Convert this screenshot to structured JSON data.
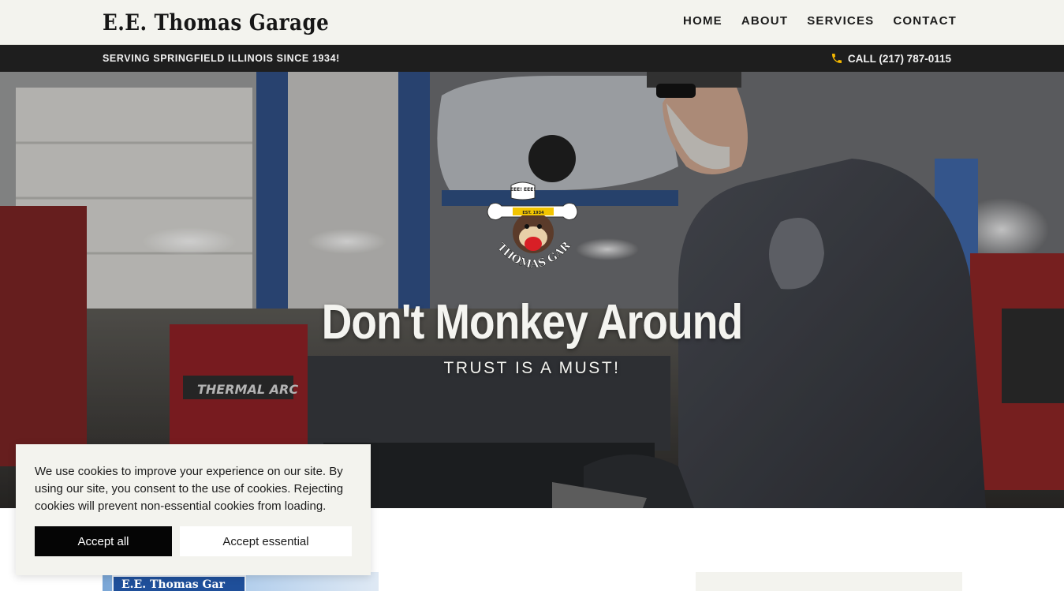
{
  "header": {
    "brand": "E.E. Thomas Garage",
    "nav": [
      "HOME",
      "ABOUT",
      "SERVICES",
      "CONTACT"
    ]
  },
  "topbar": {
    "tagline": "SERVING SPRINGFIELD ILLINOIS SINCE 1934!",
    "call": "CALL (217) 787-0115",
    "icon": "phone-icon",
    "icon_color": "#f5b800"
  },
  "hero": {
    "logo_text": "E.E. THOMAS GARAGE",
    "logo_badge": "EST. 1934",
    "logo_bubble": "EEE! EEE!",
    "title": "Don't Monkey Around",
    "subtitle": "TRUST IS A MUST!"
  },
  "promo": {
    "sign_text": "E.E. Thomas Gar"
  },
  "cookie": {
    "text": "We use cookies to improve your experience on our site. By using our site, you consent to the use of cookies. Rejecting cookies will prevent non-essential cookies from loading.",
    "accept_all": "Accept all",
    "accept_essential": "Accept essential"
  }
}
